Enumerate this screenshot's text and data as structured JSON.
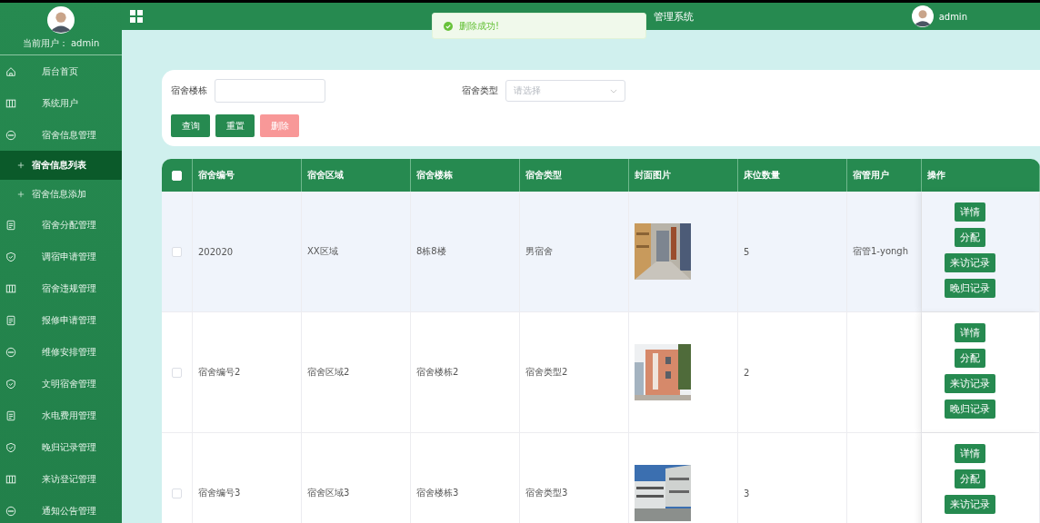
{
  "sidebar": {
    "current_user": "当前用户： admin",
    "items": [
      {
        "label": "后台首页"
      },
      {
        "label": "系统用户"
      },
      {
        "label": "宿舍信息管理",
        "children": [
          {
            "label": "宿舍信息列表",
            "selected": true
          },
          {
            "label": "宿舍信息添加",
            "selected": false
          }
        ]
      },
      {
        "label": "宿舍分配管理"
      },
      {
        "label": "调宿申请管理"
      },
      {
        "label": "宿舍违规管理"
      },
      {
        "label": "报修申请管理"
      },
      {
        "label": "维修安排管理"
      },
      {
        "label": "文明宿舍管理"
      },
      {
        "label": "水电费用管理"
      },
      {
        "label": "晚归记录管理"
      },
      {
        "label": "来访登记管理"
      },
      {
        "label": "通知公告管理"
      }
    ]
  },
  "header": {
    "title": "管理系统",
    "user": "admin"
  },
  "toast": {
    "message": "删除成功!"
  },
  "search": {
    "fields": [
      {
        "label": "宿舍楼栋",
        "kind": "input"
      },
      {
        "label": "宿舍类型",
        "kind": "select",
        "placeholder": "请选择"
      }
    ],
    "buttons": [
      {
        "label": "查询",
        "kind": "primary"
      },
      {
        "label": "重置",
        "kind": "primary"
      },
      {
        "label": "删除",
        "kind": "danger"
      }
    ]
  },
  "table": {
    "select_all": {
      "checked": false
    },
    "columns": [
      "宿舍编号",
      "宿舍区域",
      "宿舍楼栋",
      "宿舍类型",
      "封面图片",
      "床位数量",
      "宿管用户",
      "操作"
    ],
    "rows": [
      {
        "checked": false,
        "hovered": true,
        "cells": [
          "202020",
          "XX区域",
          "8栋8楼",
          "男宿舍"
        ],
        "beds": "5",
        "manager": "宿管1-yongh",
        "actions": [
          "详情",
          "分配",
          "来访记录",
          "晚归记录"
        ]
      },
      {
        "checked": false,
        "hovered": false,
        "cells": [
          "宿舍编号2",
          "宿舍区域2",
          "宿舍楼栋2",
          "宿舍类型2"
        ],
        "beds": "2",
        "actions": [
          "详情",
          "分配",
          "来访记录",
          "晚归记录"
        ]
      },
      {
        "checked": false,
        "hovered": false,
        "cells": [
          "宿舍编号3",
          "宿舍区域3",
          "宿舍楼栋3",
          "宿舍类型3"
        ],
        "beds": "3",
        "actions": [
          "详情",
          "分配",
          "来访记录"
        ]
      }
    ]
  }
}
